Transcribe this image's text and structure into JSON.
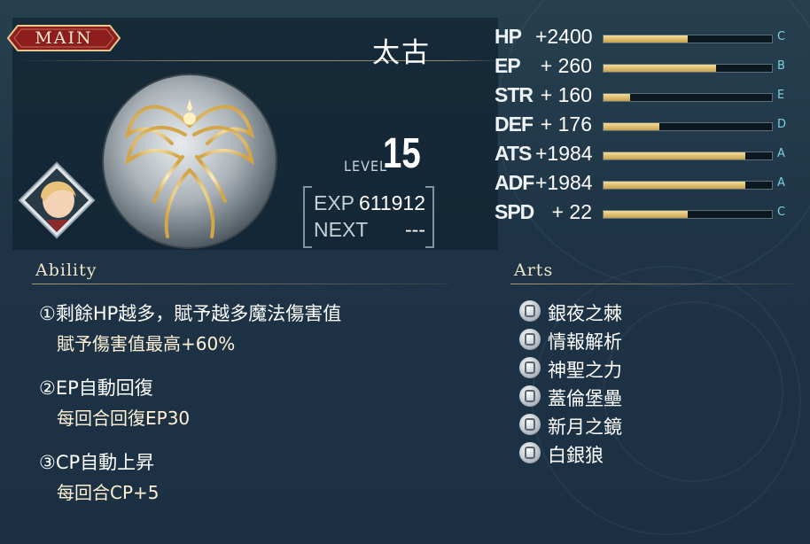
{
  "tab": {
    "label": "MAIN"
  },
  "character": {
    "name": "太古"
  },
  "level": {
    "label": "LEVEL",
    "value": "15"
  },
  "exp": {
    "exp_label": "EXP",
    "exp_value": "611912",
    "next_label": "NEXT",
    "next_value": "---"
  },
  "stats": [
    {
      "name": "HP",
      "bonus": "+2400",
      "rank": "C",
      "fill": 0.5
    },
    {
      "name": "EP",
      "bonus": "+ 260",
      "rank": "B",
      "fill": 0.67
    },
    {
      "name": "STR",
      "bonus": "+ 160",
      "rank": "E",
      "fill": 0.16
    },
    {
      "name": "DEF",
      "bonus": "+ 176",
      "rank": "D",
      "fill": 0.33
    },
    {
      "name": "ATS",
      "bonus": "+1984",
      "rank": "A",
      "fill": 0.84
    },
    {
      "name": "ADF",
      "bonus": "+1984",
      "rank": "A",
      "fill": 0.84
    },
    {
      "name": "SPD",
      "bonus": "+  22",
      "rank": "C",
      "fill": 0.5
    }
  ],
  "ability": {
    "header": "Ability",
    "items": [
      {
        "title": "①剩餘HP越多，賦予越多魔法傷害值",
        "desc": "賦予傷害值最高+60%"
      },
      {
        "title": "②EP自動回復",
        "desc": "每回合回復EP30"
      },
      {
        "title": "③CP自動上昇",
        "desc": "每回合CP+5"
      }
    ]
  },
  "arts": {
    "header": "Arts",
    "items": [
      "銀夜之棘",
      "情報解析",
      "神聖之力",
      "蓋倫堡壘",
      "新月之鏡",
      "白銀狼"
    ]
  },
  "colors": {
    "bar_fill": "#d9b864",
    "rank": "#7ed0e0",
    "tab_red": "#8e1e1e"
  }
}
